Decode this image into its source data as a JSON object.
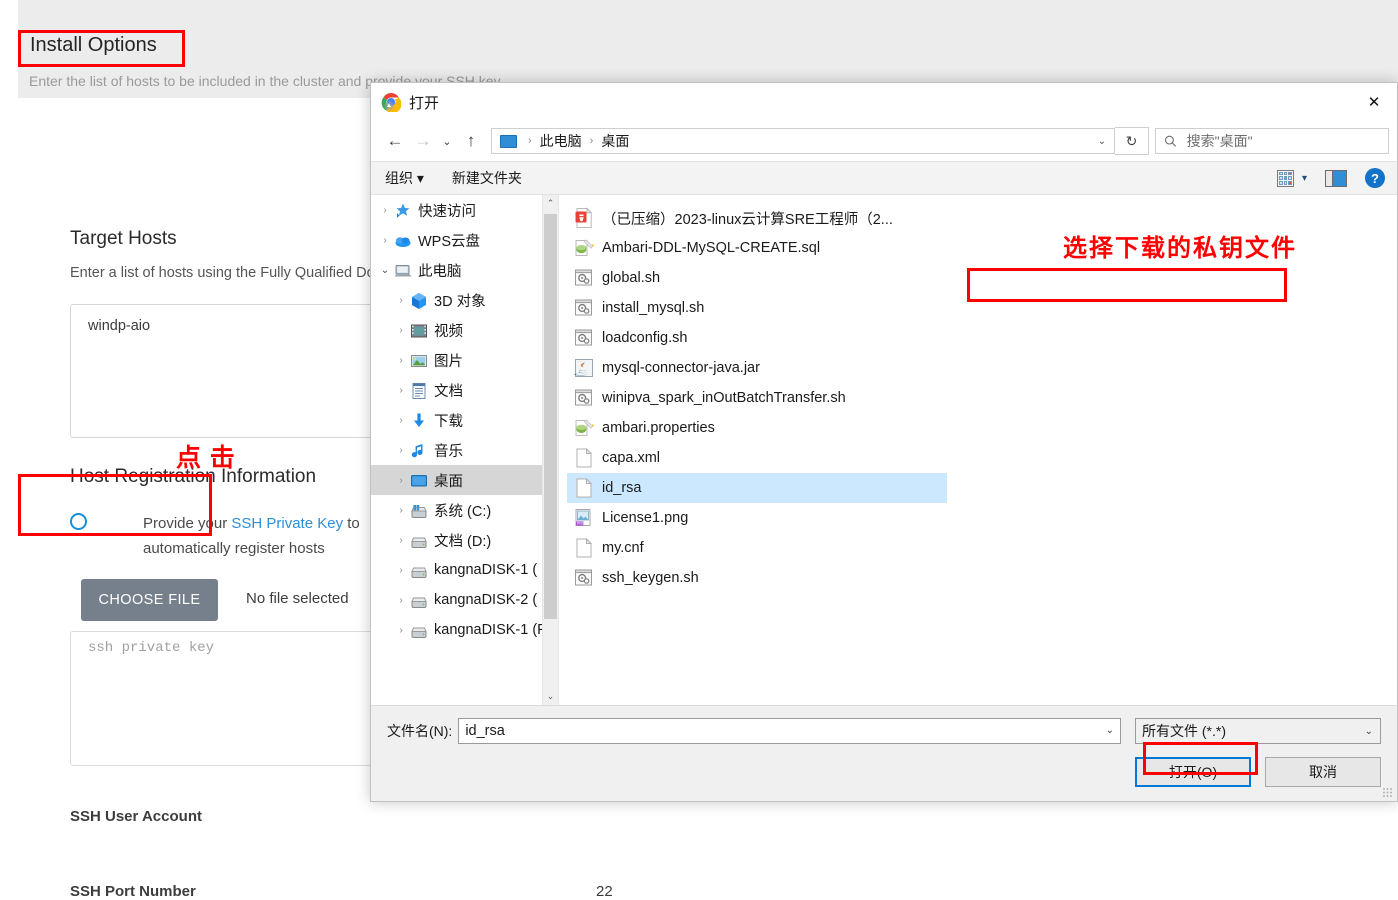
{
  "ambari": {
    "page_title": "Install Options",
    "page_subtitle": "Enter the list of hosts to be included in the cluster and provide your SSH key",
    "target_hosts": {
      "title": "Target Hosts",
      "subtitle": "Enter a list of hosts using the Fully Qualified Domain Name (FQDN), one per line",
      "value": "windp-aio"
    },
    "host_registration": {
      "title": "Host Registration Information",
      "radio_prefix": "Provide your ",
      "radio_link": "SSH Private Key",
      "radio_suffix": " to automatically register hosts",
      "choose_file_label": "CHOOSE FILE",
      "no_file_selected": "No file selected",
      "key_placeholder": "ssh private key"
    },
    "ssh_user_account_label": "SSH User Account",
    "ssh_port_number_label": "SSH Port Number",
    "ssh_port_number_value": "22"
  },
  "annotations": {
    "click_text": "点 击",
    "select_key_text": "选择下载的私钥文件",
    "color": "#ff0000"
  },
  "dialog": {
    "title": "打开",
    "close_label": "✕",
    "nav": {
      "back": "←",
      "forward": "→",
      "recent": "⌄",
      "up": "↑"
    },
    "breadcrumb": [
      "此电脑",
      "桌面"
    ],
    "refresh_label": "↻",
    "search_placeholder": "搜索\"桌面\"",
    "commandbar": {
      "organize": "组织",
      "organize_caret": "▾",
      "new_folder": "新建文件夹",
      "view_caret": "▾"
    },
    "tree": [
      {
        "label": "快速访问",
        "icon": "quick-access-icon",
        "indent": 0,
        "expandable": true,
        "expanded": false,
        "selected": false
      },
      {
        "label": "WPS云盘",
        "icon": "cloud-icon",
        "indent": 0,
        "expandable": true,
        "expanded": false,
        "selected": false
      },
      {
        "label": "此电脑",
        "icon": "computer-icon",
        "indent": 0,
        "expandable": true,
        "expanded": true,
        "selected": false
      },
      {
        "label": "3D 对象",
        "icon": "3d-object-icon",
        "indent": 1,
        "expandable": true,
        "expanded": false,
        "selected": false
      },
      {
        "label": "视频",
        "icon": "video-icon",
        "indent": 1,
        "expandable": true,
        "expanded": false,
        "selected": false
      },
      {
        "label": "图片",
        "icon": "picture-icon",
        "indent": 1,
        "expandable": true,
        "expanded": false,
        "selected": false
      },
      {
        "label": "文档",
        "icon": "document-icon",
        "indent": 1,
        "expandable": true,
        "expanded": false,
        "selected": false
      },
      {
        "label": "下载",
        "icon": "download-icon",
        "indent": 1,
        "expandable": true,
        "expanded": false,
        "selected": false
      },
      {
        "label": "音乐",
        "icon": "music-icon",
        "indent": 1,
        "expandable": true,
        "expanded": false,
        "selected": false
      },
      {
        "label": "桌面",
        "icon": "desktop-icon",
        "indent": 1,
        "expandable": true,
        "expanded": false,
        "selected": true
      },
      {
        "label": "系统 (C:)",
        "icon": "system-drive-icon",
        "indent": 1,
        "expandable": true,
        "expanded": false,
        "selected": false
      },
      {
        "label": "文档 (D:)",
        "icon": "drive-icon",
        "indent": 1,
        "expandable": true,
        "expanded": false,
        "selected": false
      },
      {
        "label": "kangnaDISK-1 (",
        "icon": "drive-icon",
        "indent": 1,
        "expandable": true,
        "expanded": false,
        "selected": false
      },
      {
        "label": "kangnaDISK-2 (",
        "icon": "drive-icon",
        "indent": 1,
        "expandable": true,
        "expanded": false,
        "selected": false
      },
      {
        "label": "kangnaDISK-1 (F",
        "icon": "drive-icon",
        "indent": 1,
        "expandable": true,
        "expanded": false,
        "selected": false
      }
    ],
    "files": [
      {
        "name": "（已压缩）2023-linux云计算SRE工程师（2...",
        "icon": "zip-icon",
        "selected": false
      },
      {
        "name": "Ambari-DDL-MySQL-CREATE.sql",
        "icon": "sql-icon",
        "selected": false
      },
      {
        "name": "global.sh",
        "icon": "shell-icon",
        "selected": false
      },
      {
        "name": "install_mysql.sh",
        "icon": "shell-icon",
        "selected": false
      },
      {
        "name": "loadconfig.sh",
        "icon": "shell-icon",
        "selected": false
      },
      {
        "name": "mysql-connector-java.jar",
        "icon": "java-icon",
        "selected": false
      },
      {
        "name": "winipva_spark_inOutBatchTransfer.sh",
        "icon": "shell-icon",
        "selected": false
      },
      {
        "name": "ambari.properties",
        "icon": "properties-icon",
        "selected": false
      },
      {
        "name": "capa.xml",
        "icon": "file-icon",
        "selected": false
      },
      {
        "name": "id_rsa",
        "icon": "file-icon",
        "selected": true
      },
      {
        "name": "License1.png",
        "icon": "png-icon",
        "selected": false
      },
      {
        "name": "my.cnf",
        "icon": "file-icon",
        "selected": false
      },
      {
        "name": "ssh_keygen.sh",
        "icon": "shell-icon",
        "selected": false
      }
    ],
    "bottom": {
      "filename_label": "文件名(N):",
      "filename_value": "id_rsa",
      "filetype_value": "所有文件 (*.*)",
      "open_button": "打开(O)",
      "cancel_button": "取消"
    }
  }
}
